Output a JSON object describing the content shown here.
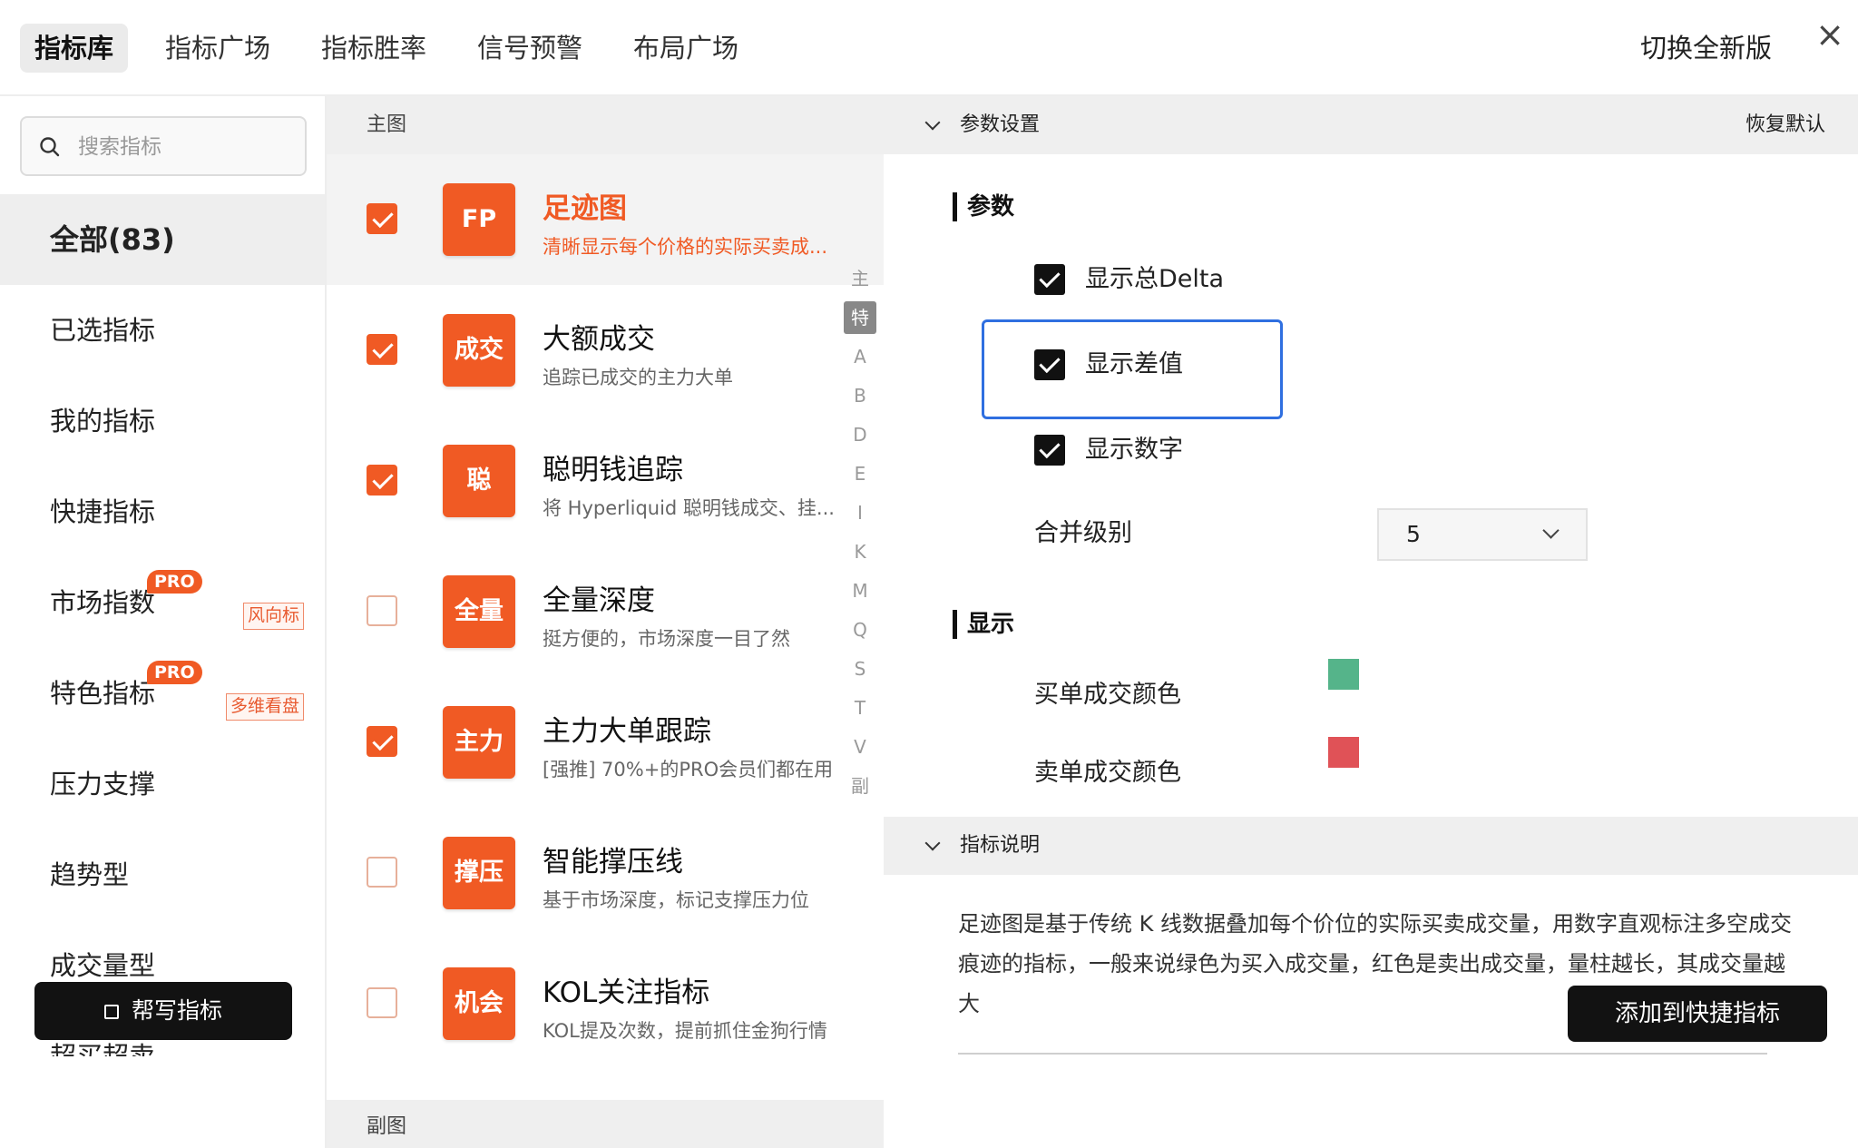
{
  "tabs": [
    {
      "label": "指标库",
      "active": true
    },
    {
      "label": "指标广场"
    },
    {
      "label": "指标胜率"
    },
    {
      "label": "信号预警"
    },
    {
      "label": "布局广场"
    }
  ],
  "switch_version": "切换全新版",
  "close_icon": "×",
  "search": {
    "placeholder": "搜索指标",
    "value": ""
  },
  "categories": [
    {
      "label": "全部(83)",
      "active": true
    },
    {
      "label": "已选指标"
    },
    {
      "label": "我的指标"
    },
    {
      "label": "快捷指标"
    },
    {
      "label": "市场指数",
      "pro": "PRO",
      "tag": "风向标"
    },
    {
      "label": "特色指标",
      "pro": "PRO",
      "tag": "多维看盘"
    },
    {
      "label": "压力支撑"
    },
    {
      "label": "趋势型"
    },
    {
      "label": "成交量型"
    },
    {
      "label": "超买超卖"
    }
  ],
  "help_button": "帮写指标",
  "main_section": "主图",
  "sub_section": "副图",
  "indicators": [
    {
      "badge": "FP",
      "title": "足迹图",
      "desc": "清晰显示每个价格的实际买卖成...",
      "checked": true,
      "selected": true
    },
    {
      "badge": "成交",
      "title": "大额成交",
      "desc": "追踪已成交的主力大单",
      "checked": true
    },
    {
      "badge": "聪",
      "title": "聪明钱追踪",
      "desc": "将 Hyperliquid 聪明钱成交、挂...",
      "checked": true
    },
    {
      "badge": "全量",
      "title": "全量深度",
      "desc": "挺方便的，市场深度一目了然",
      "checked": false
    },
    {
      "badge": "主力",
      "title": "主力大单跟踪",
      "desc": "[强推] 70%+的PRO会员们都在用",
      "checked": true
    },
    {
      "badge": "撑压",
      "title": "智能撑压线",
      "desc": "基于市场深度，标记支撑压力位",
      "checked": false
    },
    {
      "badge": "机会",
      "title": "KOL关注指标",
      "desc": "KOL提及次数，提前抓住金狗行情",
      "checked": false
    }
  ],
  "alpha_index": [
    "主",
    "特",
    "A",
    "B",
    "D",
    "E",
    "I",
    "K",
    "M",
    "Q",
    "S",
    "T",
    "V",
    "副"
  ],
  "alpha_current": "特",
  "params": {
    "header": "参数设置",
    "reset": "恢复默认",
    "group_params": "参数",
    "options": [
      {
        "label": "显示总Delta",
        "checked": true
      },
      {
        "label": "显示差值",
        "checked": true
      },
      {
        "label": "显示数字",
        "checked": true
      }
    ],
    "merge_label": "合并级别",
    "merge_value": "5",
    "group_display": "显示",
    "buy_color_label": "买单成交颜色",
    "buy_color": "#55b48a",
    "sell_color_label": "卖单成交颜色",
    "sell_color": "#e05257"
  },
  "description": {
    "header": "指标说明",
    "text": "足迹图是基于传统 K 线数据叠加每个价位的实际买卖成交量，用数字直观标注多空成交痕迹的指标，一般来说绿色为买入成交量，红色是卖出成交量，量柱越长，其成交量越大"
  },
  "add_button": "添加到快捷指标",
  "colors": {
    "accent": "#f05a24",
    "focus": "#2f6fe0",
    "dark_button": "#121212"
  }
}
